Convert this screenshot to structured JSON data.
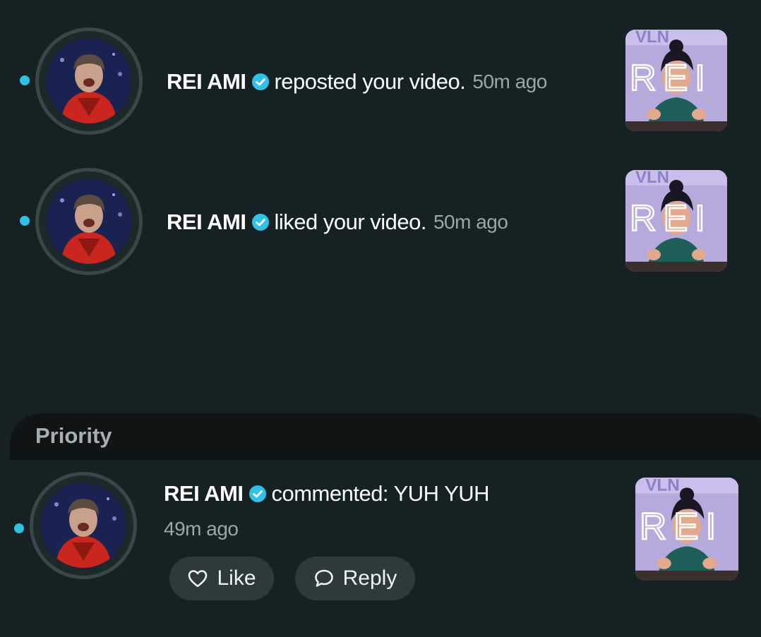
{
  "notifications": [
    {
      "username": "REI AMI",
      "action": "reposted your video.",
      "time": "50m ago",
      "thumb_text": "REI"
    },
    {
      "username": "REI AMI",
      "action": "liked your video.",
      "time": "50m ago",
      "thumb_text": "REI"
    }
  ],
  "priority": {
    "section_label": "Priority",
    "comment": {
      "username": "REI AMI",
      "action": "commented: YUH YUH",
      "time": "49m ago",
      "thumb_text": "REI",
      "like_label": "Like",
      "reply_label": "Reply"
    }
  },
  "colors": {
    "accent_dot": "#2fc2e6",
    "verified": "#2fc2e6",
    "background": "#152122"
  },
  "icons": [
    "verified-badge-icon",
    "heart-outline-icon",
    "speech-bubble-icon"
  ]
}
